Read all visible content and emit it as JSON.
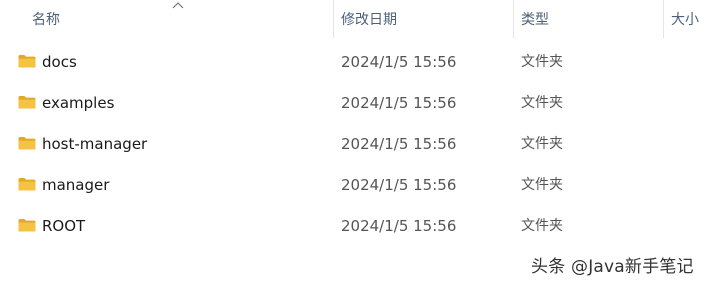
{
  "columns": {
    "name": "名称",
    "modified": "修改日期",
    "type": "类型",
    "size": "大小"
  },
  "sort": {
    "column": "name",
    "direction": "ascending",
    "icon": "sort-up-arrow-icon"
  },
  "rows": [
    {
      "name": "docs",
      "modified": "2024/1/5 15:56",
      "type": "文件夹",
      "icon": "folder-icon"
    },
    {
      "name": "examples",
      "modified": "2024/1/5 15:56",
      "type": "文件夹",
      "icon": "folder-icon"
    },
    {
      "name": "host-manager",
      "modified": "2024/1/5 15:56",
      "type": "文件夹",
      "icon": "folder-icon"
    },
    {
      "name": "manager",
      "modified": "2024/1/5 15:56",
      "type": "文件夹",
      "icon": "folder-icon"
    },
    {
      "name": "ROOT",
      "modified": "2024/1/5 15:56",
      "type": "文件夹",
      "icon": "folder-icon"
    }
  ],
  "colors": {
    "folder": "#f5c343",
    "folder_dark": "#e0a928",
    "header_text": "#4c607a"
  },
  "watermark": "头条 @Java新手笔记"
}
